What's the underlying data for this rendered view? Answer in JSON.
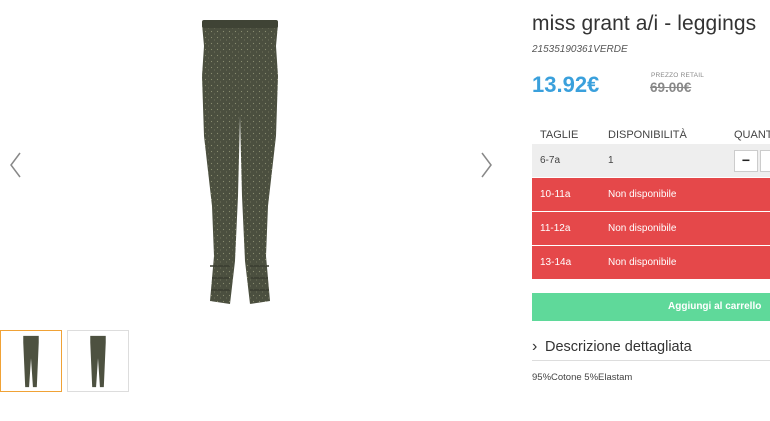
{
  "product": {
    "title": "miss grant a/i - leggings",
    "sku": "21535190361VERDE",
    "price": "13.92€",
    "retail_label": "PREZZO RETAIL",
    "retail_price": "69.00€"
  },
  "sizes_table": {
    "headers": {
      "size": "TAGLIE",
      "availability": "DISPONIBILITÀ",
      "quantity": "QUANT"
    },
    "rows": [
      {
        "size": "6-7a",
        "availability": "1",
        "available": true
      },
      {
        "size": "10-11a",
        "availability": "Non disponibile",
        "available": false
      },
      {
        "size": "11-12a",
        "availability": "Non disponibile",
        "available": false
      },
      {
        "size": "13-14a",
        "availability": "Non disponibile",
        "available": false
      }
    ],
    "qty_minus": "−"
  },
  "cart_button_label": "Aggiungi al carrello",
  "description": {
    "toggle_label": "Descrizione dettagliata",
    "chevron": "›",
    "composition": "95%Cotone 5%Elastam"
  },
  "colors": {
    "price": "#3aa0dc",
    "unavailable": "#e5484a",
    "cart_button": "#5fd99a",
    "thumb_active_border": "#f0a236",
    "leggings": "#4d5140"
  },
  "icons": [
    "chevron-left-icon",
    "chevron-right-icon"
  ]
}
